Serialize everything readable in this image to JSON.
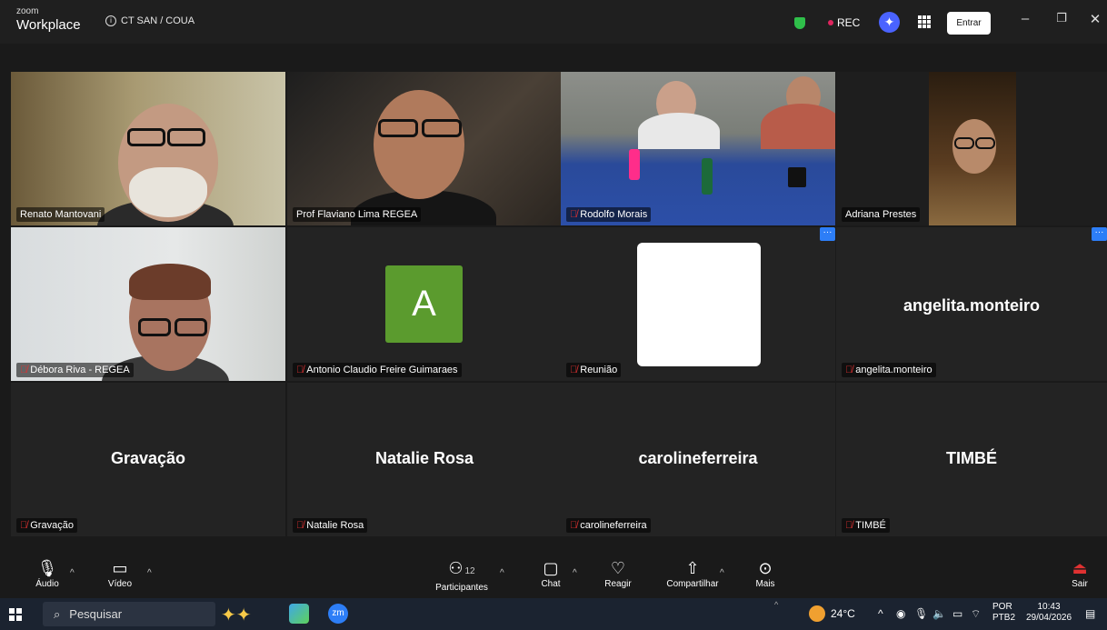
{
  "titlebar": {
    "brand_small": "zoom",
    "brand": "Workplace",
    "meeting": "CT SAN / COUA",
    "rec": "REC",
    "entrar": "Entrar"
  },
  "tiles": [
    {
      "name": "Renato Mantovani",
      "muted": false
    },
    {
      "name": "Prof Flaviano Lima REGEA",
      "muted": false
    },
    {
      "name": "Rodolfo Morais",
      "muted": true
    },
    {
      "name": "Adriana Prestes",
      "muted": false
    },
    {
      "name": "Débora Riva - REGEA",
      "muted": true
    },
    {
      "name": "Antonio Claudio Freire Guimaraes",
      "muted": true,
      "initial": "A"
    },
    {
      "name": "Reunião",
      "muted": true
    },
    {
      "name": "angelita.monteiro",
      "muted": true,
      "display": "angelita.monteiro"
    },
    {
      "name": "Gravação",
      "muted": true,
      "display": "Gravação"
    },
    {
      "name": "Natalie Rosa",
      "muted": true,
      "display": "Natalie Rosa"
    },
    {
      "name": "carolineferreira",
      "muted": true,
      "display": "carolineferreira"
    },
    {
      "name": "TIMBÉ",
      "muted": true,
      "display": "TIMBÉ"
    }
  ],
  "toolbar": {
    "audio": "Áudio",
    "video": "Vídeo",
    "participants": "Participantes",
    "participants_count": "12",
    "chat": "Chat",
    "react": "Reagir",
    "share": "Compartilhar",
    "more": "Mais",
    "leave": "Sair"
  },
  "taskbar": {
    "search_placeholder": "Pesquisar",
    "temp": "24°C",
    "lang1": "POR",
    "lang2": "PTB2",
    "time": "10:43",
    "date": "29/04/2026",
    "zm": "zm"
  },
  "colors": {
    "active_speaker": "#3ddc84",
    "avatar": "#5b9b2e",
    "accent": "#2d7ef7"
  }
}
